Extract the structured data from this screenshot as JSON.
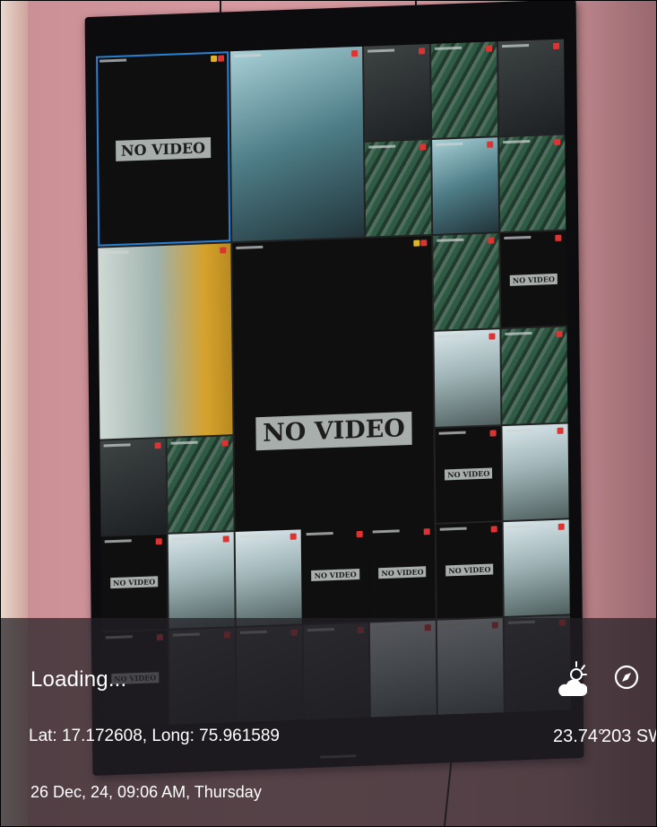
{
  "scene": {
    "monitor_tiles": [
      {
        "kind": "nov",
        "size": "big",
        "label": "NO VIDEO",
        "selected": true,
        "span": "2x2"
      },
      {
        "kind": "cam",
        "tone": "blue",
        "span": "2x2"
      },
      {
        "kind": "cam",
        "tone": "dark"
      },
      {
        "kind": "cam",
        "tone": "green"
      },
      {
        "kind": "cam",
        "tone": "dark"
      },
      {
        "kind": "cam",
        "tone": "green"
      },
      {
        "kind": "cam",
        "tone": "blue"
      },
      {
        "kind": "cam",
        "tone": "green"
      },
      {
        "kind": "cam",
        "tone": "yellow",
        "span": "2x2"
      },
      {
        "kind": "nov",
        "size": "huge",
        "label": "NO VIDEO",
        "span": "3x3"
      },
      {
        "kind": "cam",
        "tone": "green"
      },
      {
        "kind": "nov",
        "label": "NO VIDEO"
      },
      {
        "kind": "cam",
        "tone": "bright"
      },
      {
        "kind": "cam",
        "tone": "green"
      },
      {
        "kind": "cam",
        "tone": "dark"
      },
      {
        "kind": "cam",
        "tone": "green"
      },
      {
        "kind": "nov",
        "label": "NO VIDEO"
      },
      {
        "kind": "cam",
        "tone": "bright"
      },
      {
        "kind": "nov",
        "label": "NO VIDEO"
      },
      {
        "kind": "cam",
        "tone": "bright"
      },
      {
        "kind": "nov",
        "label": "NO VIDEO"
      },
      {
        "kind": "cam",
        "tone": "bright"
      },
      {
        "kind": "cam",
        "tone": "bright"
      },
      {
        "kind": "nov",
        "label": "NO VIDEO"
      },
      {
        "kind": "nov",
        "label": "NO VIDEO"
      },
      {
        "kind": "nov",
        "label": "NO VIDEO"
      },
      {
        "kind": "cam",
        "tone": "dark"
      },
      {
        "kind": "cam",
        "tone": "dark"
      },
      {
        "kind": "cam",
        "tone": "dark"
      },
      {
        "kind": "cam",
        "tone": "bright"
      },
      {
        "kind": "cam",
        "tone": "bright"
      },
      {
        "kind": "cam",
        "tone": "dark"
      },
      {
        "kind": "cam",
        "tone": "dark"
      }
    ]
  },
  "overlay": {
    "status": "Loading...",
    "coordinates": "Lat: 17.172608, Long: 75.961589",
    "datetime": "26 Dec, 24, 09:06 AM, Thursday",
    "temperature": "23.74°",
    "heading": "203 SW",
    "weather_icon": "cloud-sun-icon",
    "compass_icon": "compass-icon"
  }
}
